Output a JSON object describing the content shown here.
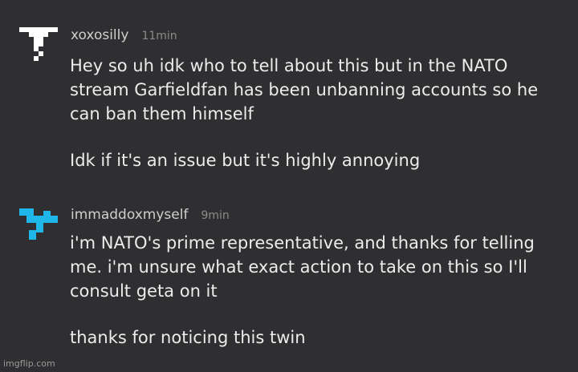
{
  "comments": [
    {
      "username": "xoxosilly",
      "timestamp": "11min",
      "avatar_icon": "white-pixel-t-icon",
      "avatar_color": "#ffffff",
      "paragraphs": [
        "Hey so uh idk who to tell about this but in the NATO stream Garfieldfan has been unbanning accounts so he can ban them himself",
        "Idk if it's an issue but it's highly annoying"
      ]
    },
    {
      "username": "immaddoxmyself",
      "timestamp": "9min",
      "avatar_icon": "cyan-pixel-cross-icon",
      "avatar_color": "#1fb7e9",
      "paragraphs": [
        "i'm NATO's prime representative, and thanks for telling me. i'm unsure what exact action to take on this so I'll consult geta on it",
        "thanks for noticing this twin"
      ]
    }
  ],
  "watermark": "imgflip.com"
}
